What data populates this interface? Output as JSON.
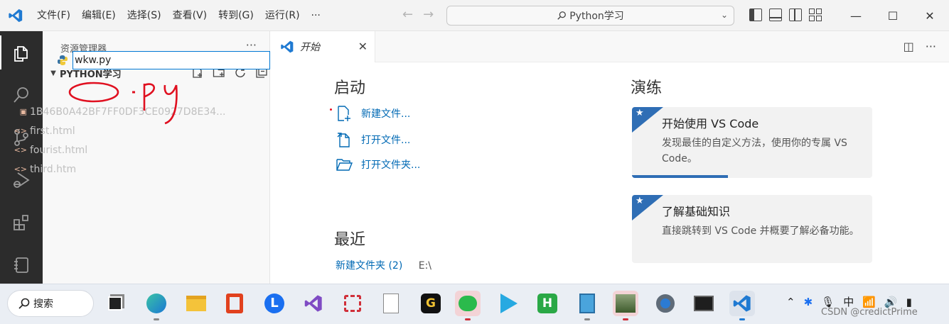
{
  "titlebar": {
    "menus": [
      "文件(F)",
      "编辑(E)",
      "选择(S)",
      "查看(V)",
      "转到(G)",
      "运行(R)",
      "···"
    ],
    "command_center": "Python学习"
  },
  "sidebar": {
    "title": "资源管理器",
    "more": "···",
    "folder_name": "PYTHON学习",
    "rename_value": "wkw.py",
    "files": [
      "1B46B0A42BF7FF0DF3CE0927D8E34...",
      "first.html",
      "fourist.html",
      "third.htm"
    ]
  },
  "tab": {
    "label": "开始",
    "close": "✕"
  },
  "editor_actions": [
    "◫",
    "···"
  ],
  "welcome": {
    "start_heading": "启动",
    "start_items": [
      "新建文件...",
      "打开文件...",
      "打开文件夹..."
    ],
    "recent_heading": "最近",
    "recent_items": [
      {
        "name": "新建文件夹 (2)",
        "path": "E:\\"
      }
    ],
    "walkthrough_heading": "演练",
    "cards": [
      {
        "title": "开始使用 VS Code",
        "desc": "发现最佳的自定义方法，使用你的专属 VS Code。",
        "progress": 0.4
      },
      {
        "title": "了解基础知识",
        "desc": "直接跳转到 VS Code 并概要了解必备功能。"
      }
    ]
  },
  "annotation_text": ".PY",
  "taskbar": {
    "search_label": "搜索",
    "ime": "中",
    "watermark": "CSDN @credictPrime"
  }
}
